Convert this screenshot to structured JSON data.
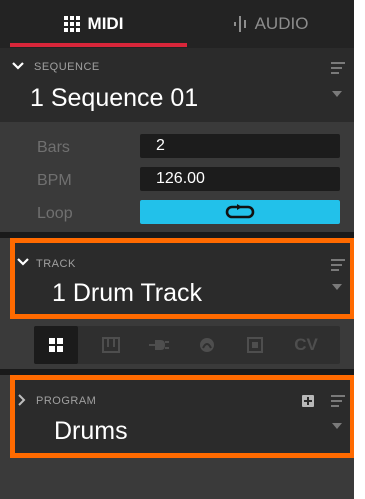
{
  "tabs": [
    {
      "label": "MIDI",
      "icon": "grid-icon",
      "active": true
    },
    {
      "label": "AUDIO",
      "icon": "waveform-icon",
      "active": false
    }
  ],
  "sequence": {
    "label": "SEQUENCE",
    "value": "1 Sequence 01"
  },
  "params": {
    "bars_label": "Bars",
    "bars_value": "2",
    "bpm_label": "BPM",
    "bpm_value": "126.00",
    "loop_label": "Loop",
    "loop_icon": "loop-icon"
  },
  "track": {
    "label": "TRACK",
    "value": "1 Drum Track"
  },
  "views": {
    "items": [
      "grid-view-icon",
      "piano-roll-icon",
      "plug-icon",
      "circle-icon",
      "square-icon"
    ],
    "cv_label": "CV",
    "active_index": 0
  },
  "program": {
    "label": "PROGRAM",
    "value": "Drums",
    "add_icon": "plus-icon"
  },
  "colors": {
    "accent": "#22c1ea",
    "tab_underline": "#d8263a",
    "highlight": "#ff6a00"
  }
}
